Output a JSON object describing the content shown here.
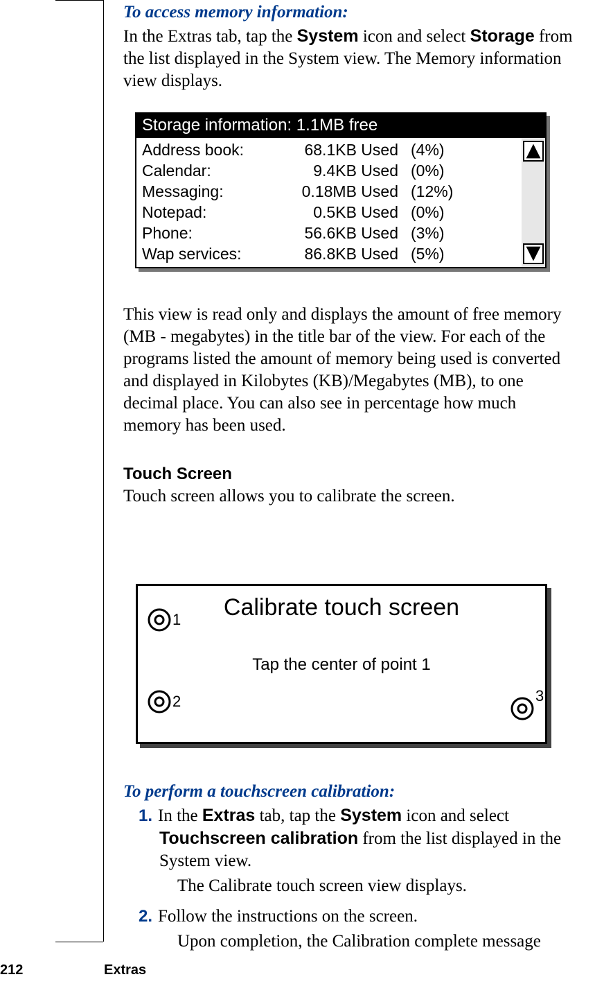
{
  "heading1": "To access memory information:",
  "para1_pre": "In the Extras tab, tap the ",
  "para1_b1": "System",
  "para1_mid": " icon and select ",
  "para1_b2": "Storage",
  "para1_post": " from the list displayed in the System view. The Memory information view displays.",
  "storage": {
    "title": "Storage information: 1.1MB free",
    "rows": [
      {
        "label": "Address book:",
        "used": "68.1KB Used",
        "pct": "(4%)"
      },
      {
        "label": "Calendar:",
        "used": "9.4KB Used",
        "pct": "(0%)"
      },
      {
        "label": "Messaging:",
        "used": "0.18MB Used",
        "pct": "(12%)"
      },
      {
        "label": "Notepad:",
        "used": "0.5KB Used",
        "pct": "(0%)"
      },
      {
        "label": "Phone:",
        "used": "56.6KB Used",
        "pct": "(3%)"
      },
      {
        "label": "Wap services:",
        "used": "86.8KB Used",
        "pct": "(5%)"
      }
    ]
  },
  "para2": "This view is read only and displays the amount of free memory (MB - megabytes) in the title bar of the view. For each of the programs listed the amount of memory being used is converted and displayed in Kilobytes (KB)/Megabytes (MB), to one decimal place. You can also see in percentage how much memory has been used.",
  "touch_heading": "Touch Screen",
  "touch_intro": "Touch screen allows you to calibrate the screen.",
  "calibrate": {
    "title": "Calibrate touch screen",
    "instruction": "Tap the center of point 1",
    "p1": "1",
    "p2": "2",
    "p3": "3"
  },
  "heading2": "To perform a touchscreen calibration:",
  "step1_num": "1.",
  "step1_a": "In the ",
  "step1_b1": "Extras",
  "step1_b": " tab, tap the ",
  "step1_b2": "System",
  "step1_c": " icon and select ",
  "step1_b3": "Touchscreen calibration",
  "step1_d": " from the list displayed in the System view.",
  "step1_sub": "The Calibrate touch screen view displays.",
  "step2_num": "2.",
  "step2_a": "Follow the instructions on the screen.",
  "step2_sub": "Upon completion, the Calibration complete message",
  "footer": {
    "page": "212",
    "section": "Extras"
  }
}
